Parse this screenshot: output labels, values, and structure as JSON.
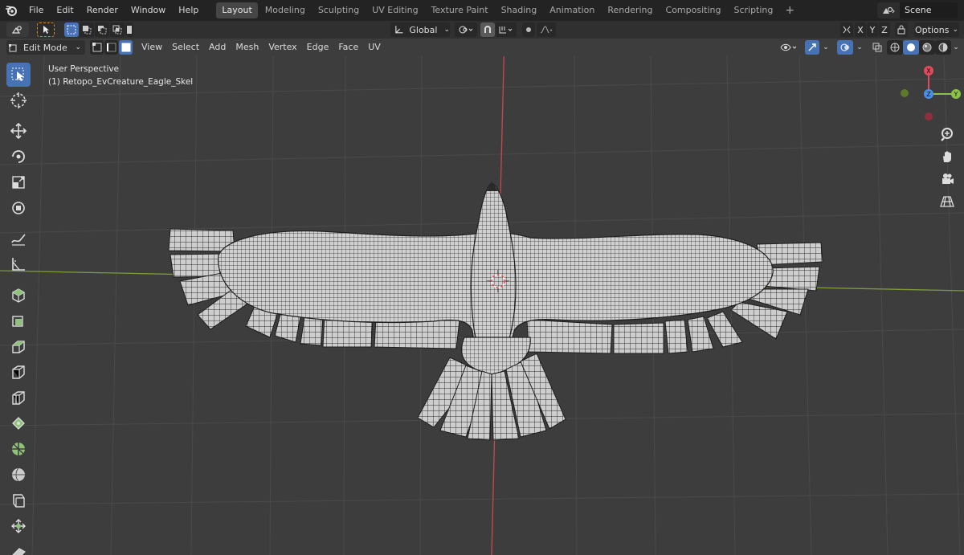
{
  "menubar": {
    "items": [
      "File",
      "Edit",
      "Render",
      "Window",
      "Help"
    ],
    "workspaces": [
      "Layout",
      "Modeling",
      "Sculpting",
      "UV Editing",
      "Texture Paint",
      "Shading",
      "Animation",
      "Rendering",
      "Compositing",
      "Scripting"
    ],
    "active_workspace": "Layout",
    "add_tab": "+",
    "scene_label": "Scene"
  },
  "toolhdr": {
    "orientation": "Global",
    "options_label": "Options",
    "axes": [
      "X",
      "Y",
      "Z"
    ]
  },
  "vphdr": {
    "mode": "Edit Mode",
    "menus": [
      "View",
      "Select",
      "Add",
      "Mesh",
      "Vertex",
      "Edge",
      "Face",
      "UV"
    ]
  },
  "viewport": {
    "perspective": "User Perspective",
    "object": "(1) Retopo_EvCreature_Eagle_Skel"
  },
  "gizmo": {
    "x": "X",
    "y": "Y",
    "z": "Z"
  },
  "tools": [
    "select-box-tool",
    "cursor-tool",
    "move-tool",
    "rotate-tool",
    "scale-tool",
    "transform-tool",
    "annotate-tool",
    "measure-tool",
    "add-cube-tool",
    "extrude-tool",
    "inset-tool",
    "bevel-tool",
    "loop-cut-tool",
    "knife-tool",
    "poly-build-tool",
    "spin-tool",
    "smooth-tool",
    "shrink-fatten-tool",
    "shear-tool"
  ],
  "colors": {
    "accent": "#4772b3",
    "axis_x": "#e14a5c",
    "axis_y": "#8bc34a",
    "axis_z": "#4a90e2",
    "mesh": "#c9c9c9",
    "wire": "#1e1e1e"
  }
}
